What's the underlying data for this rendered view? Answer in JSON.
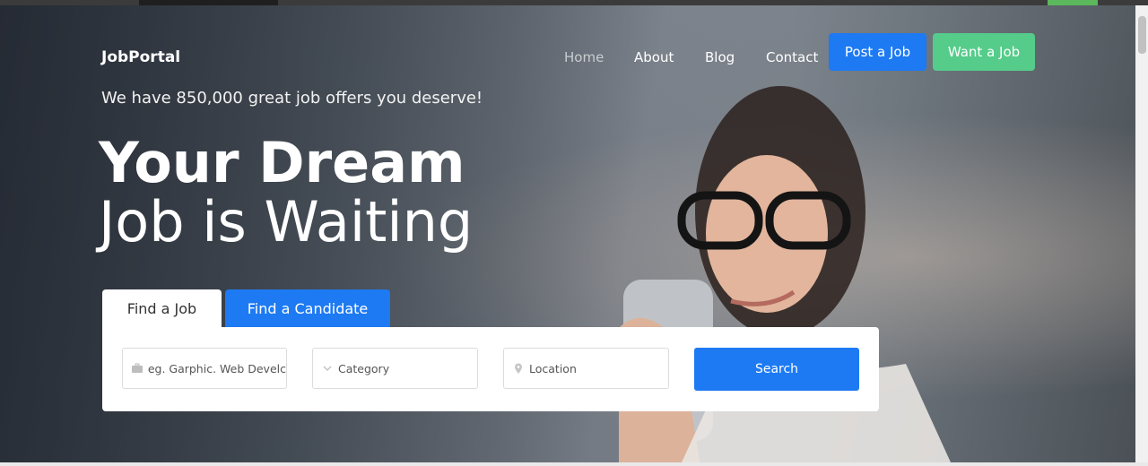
{
  "brand": {
    "logo": "JobPortal"
  },
  "nav": {
    "items": [
      "Home",
      "About",
      "Blog",
      "Contact"
    ],
    "active": "Home",
    "post_job": "Post a Job",
    "want_job": "Want a Job"
  },
  "hero": {
    "tagline": "We have 850,000 great job offers you deserve!",
    "headline_bold": "Your Dream",
    "headline_light": "Job is Waiting"
  },
  "search": {
    "tabs": [
      "Find a Job",
      "Find a Candidate"
    ],
    "active_tab": "Find a Job",
    "keyword_placeholder": "eg. Garphic. Web Develc",
    "category_placeholder": "Category",
    "location_placeholder": "Location",
    "button": "Search"
  },
  "colors": {
    "primary": "#1d7af3",
    "green": "#55cc8a"
  },
  "icons": [
    "briefcase-icon",
    "chevron-down-icon",
    "map-pin-icon"
  ]
}
